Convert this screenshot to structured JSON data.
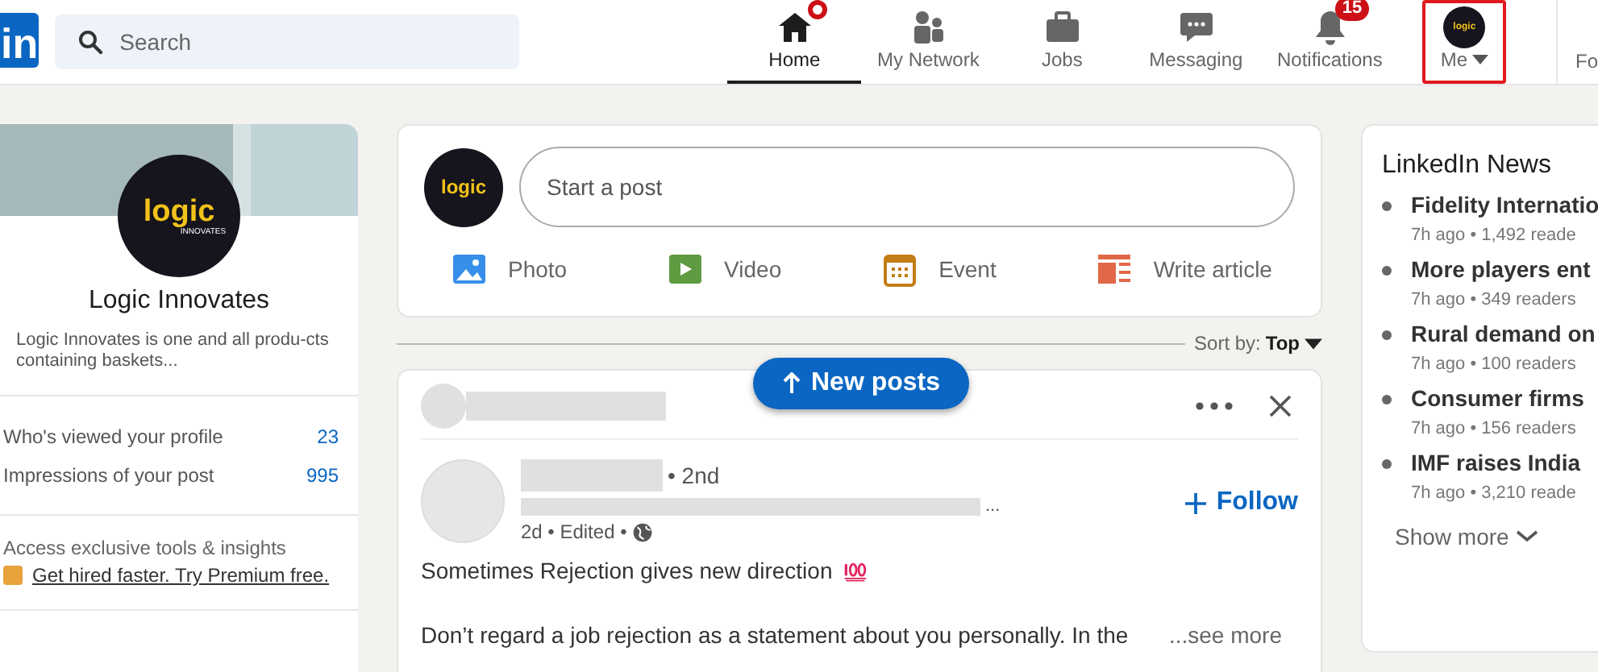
{
  "header": {
    "logo": "in",
    "search": {
      "placeholder": "Search"
    },
    "nav": [
      {
        "kind": "home",
        "label": "Home",
        "selected": true,
        "badge_dot": true
      },
      {
        "kind": "network",
        "label": "My Network",
        "selected": false
      },
      {
        "kind": "jobs",
        "label": "Jobs",
        "selected": false
      },
      {
        "kind": "messaging",
        "label": "Messaging",
        "selected": false
      },
      {
        "kind": "notifications",
        "label": "Notifications",
        "selected": false,
        "badge": "15"
      },
      {
        "kind": "me",
        "label": "Me",
        "selected": false,
        "highlighted": true,
        "avatar_word": "logic"
      }
    ],
    "cut_item": "Fo"
  },
  "profile": {
    "logo_word": "logic",
    "logo_sub": "INNOVATES",
    "name": "Logic Innovates",
    "description": "Logic Innovates is one and all produ-cts containing baskets...",
    "stats": [
      {
        "label": "Who's viewed your profile",
        "value": "23"
      },
      {
        "label": "Impressions of your post",
        "value": "995"
      }
    ],
    "premium_note": "Access exclusive tools & insights",
    "premium_link": "Get hired faster. Try Premium free."
  },
  "share": {
    "avatar_word": "logic",
    "placeholder": "Start a post",
    "actions": [
      {
        "kind": "photo",
        "label": "Photo"
      },
      {
        "kind": "video",
        "label": "Video"
      },
      {
        "kind": "event",
        "label": "Event"
      },
      {
        "kind": "article",
        "label": "Write article"
      }
    ]
  },
  "sort": {
    "label": "Sort by:",
    "value": "Top"
  },
  "new_posts": "New posts",
  "post": {
    "degree": "• 2nd",
    "subtitle_end": "...",
    "meta": "2d • Edited •",
    "follow": "Follow",
    "lines": [
      "Sometimes Rejection gives new direction",
      "Don’t regard a job rejection as a statement about you personally. In the"
    ],
    "see_more": "...see more"
  },
  "news": {
    "title": "LinkedIn News",
    "items": [
      {
        "headline": "Fidelity Internatio",
        "meta": "7h ago • 1,492 reade"
      },
      {
        "headline": "More players ent",
        "meta": "7h ago • 349 readers"
      },
      {
        "headline": "Rural demand on",
        "meta": "7h ago • 100 readers"
      },
      {
        "headline": "Consumer firms",
        "meta": "7h ago • 156 readers"
      },
      {
        "headline": "IMF raises India",
        "meta": "7h ago • 3,210 reade"
      }
    ],
    "show_more": "Show more"
  }
}
